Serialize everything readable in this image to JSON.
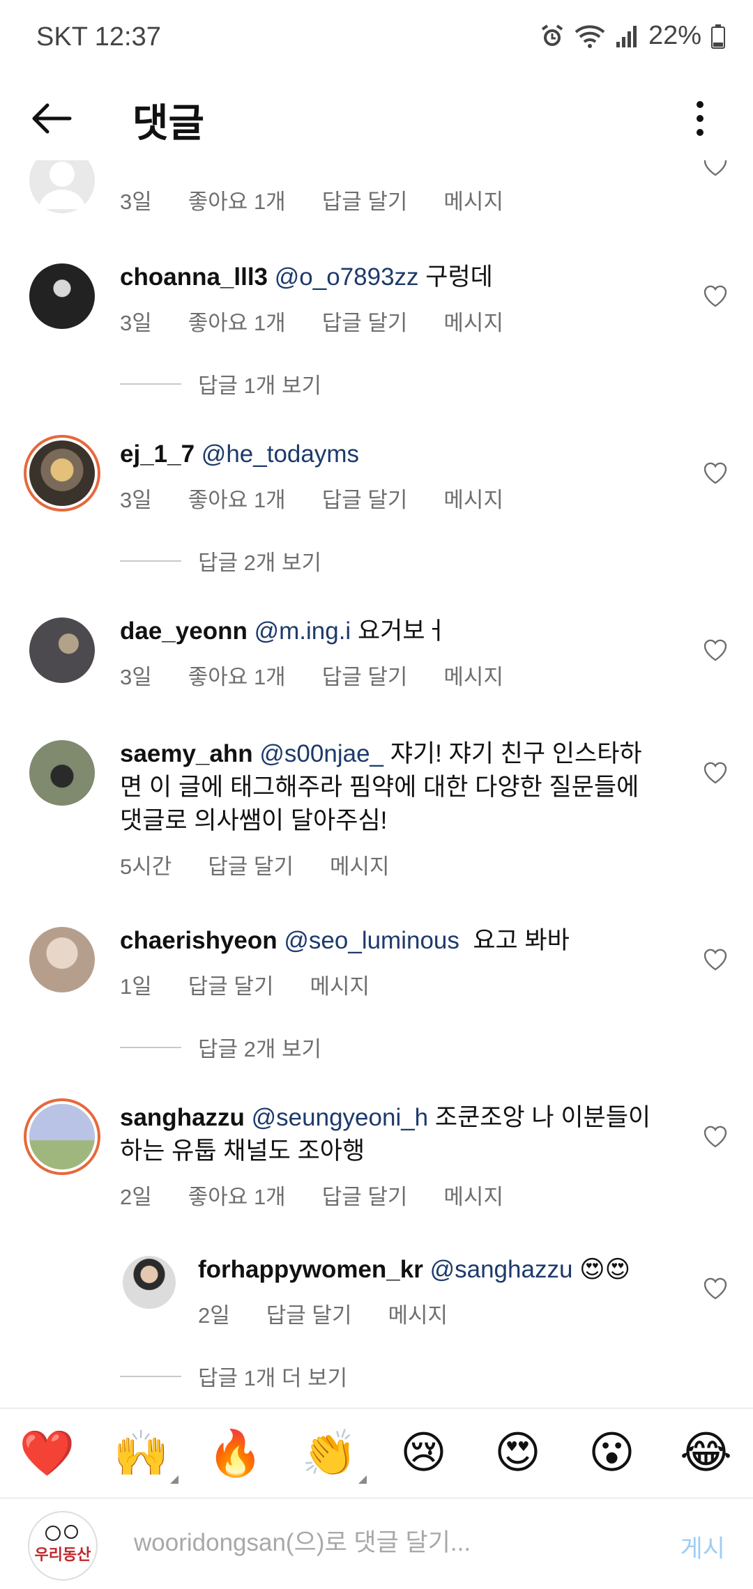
{
  "status": {
    "carrier_time": "SKT 12:37",
    "battery": "22%"
  },
  "header": {
    "title": "댓글"
  },
  "comments": [
    {
      "meta": [
        "3일",
        "좋아요 1개",
        "답글 달기",
        "메시지"
      ]
    },
    {
      "username": "choanna_lll3",
      "mention": "@o_o7893zz",
      "text": " 구렁데",
      "meta": [
        "3일",
        "좋아요 1개",
        "답글 달기",
        "메시지"
      ],
      "view_replies": "답글 1개 보기"
    },
    {
      "username": "ej_1_7",
      "mention": "@he_todayms",
      "text": "",
      "meta": [
        "3일",
        "좋아요 1개",
        "답글 달기",
        "메시지"
      ],
      "view_replies": "답글 2개 보기"
    },
    {
      "username": "dae_yeonn",
      "mention": "@m.ing.i",
      "text": " 요거보ㅓ",
      "meta": [
        "3일",
        "좋아요 1개",
        "답글 달기",
        "메시지"
      ]
    },
    {
      "username": "saemy_ahn",
      "mention": "@s00njae_",
      "text": " 쟈기! 쟈기 친구 인스타하면 이 글에 태그해주라 핌약에 대한 다양한 질문들에 댓글로 의사쌤이 달아주심!",
      "meta": [
        "5시간",
        "답글 달기",
        "메시지"
      ]
    },
    {
      "username": "chaerishyeon",
      "mention": "@seo_luminous",
      "text": "  요고 봐바",
      "meta": [
        "1일",
        "답글 달기",
        "메시지"
      ],
      "view_replies": "답글 2개 보기"
    },
    {
      "username": "sanghazzu",
      "mention": "@seungyeoni_h",
      "text": " 조쿤조앙 나 이분들이 하는 유툽 채널도 조아행",
      "meta": [
        "2일",
        "좋아요 1개",
        "답글 달기",
        "메시지"
      ]
    },
    {
      "username": "forhappywomen_kr",
      "mention": "@sanghazzu",
      "text": " 😍😍",
      "meta": [
        "2일",
        "답글 달기",
        "메시지"
      ],
      "view_replies": "답글 1개 더 보기"
    }
  ],
  "emoji_bar": [
    "❤️",
    "🙌",
    "🔥",
    "👏",
    "😢",
    "😍",
    "😮",
    "😂"
  ],
  "input": {
    "placeholder": "wooridongsan(으)로 댓글 달기...",
    "post_label": "게시",
    "avatar_text": "우리동산"
  },
  "colors": {
    "mention": "#1d3a6b",
    "meta": "#6e6e6e",
    "post_disabled": "#9fcdf5",
    "story_ring": "#e6683c"
  }
}
